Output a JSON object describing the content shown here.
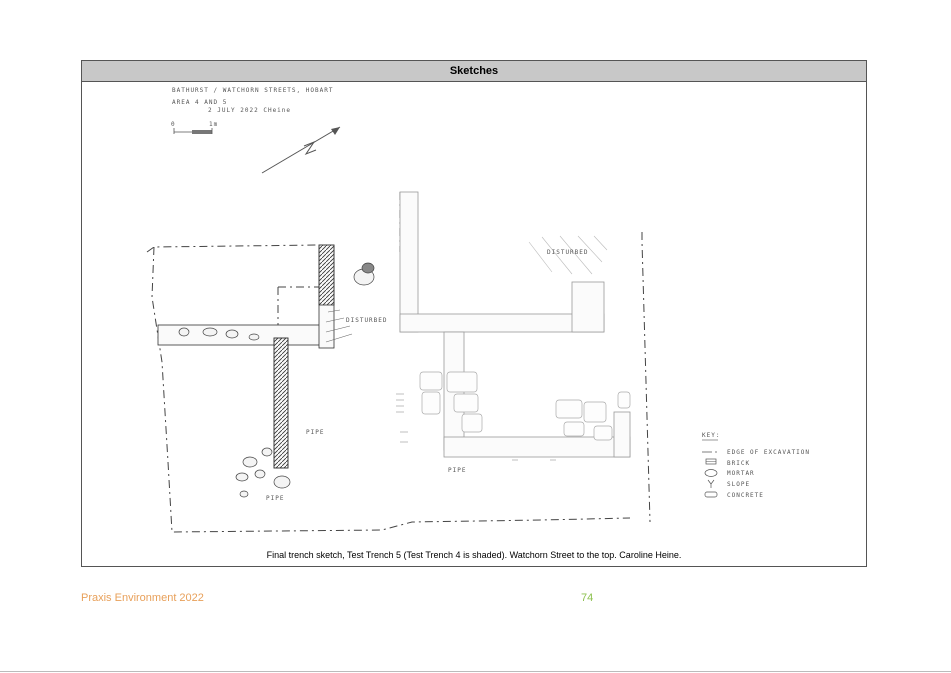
{
  "header": {
    "title": "Sketches"
  },
  "sketch": {
    "note_line1": "BATHURST / WATCHORN STREETS, HOBART",
    "note_line2": "AREA 4 AND 5",
    "note_line3": "2 JULY 2022   CHeine",
    "scale_start": "0",
    "scale_end": "1m",
    "disturbed_label_1": "DISTURBED",
    "disturbed_label_2": "DISTURBED",
    "pipe_label_1": "PIPE",
    "pipe_label_2": "PIPE",
    "pipe_label_3": "PIPE",
    "key_title": "KEY:",
    "key_items": [
      {
        "symbol": "dash-line",
        "label": "EDGE OF EXCAVATION"
      },
      {
        "symbol": "brick",
        "label": "BRICK"
      },
      {
        "symbol": "mortar",
        "label": "MORTAR"
      },
      {
        "symbol": "slope",
        "label": "SLOPE"
      },
      {
        "symbol": "concrete",
        "label": "CONCRETE"
      }
    ]
  },
  "caption": "Final trench sketch, Test Trench 5 (Test Trench 4 is shaded).  Watchorn Street to the top.  Caroline Heine.",
  "footer": {
    "publisher": "Praxis Environment 2022",
    "page_number": "74"
  },
  "colors": {
    "footer_left": "#e8a05a",
    "footer_page": "#8cc04e",
    "header_bg": "#c8c8c8"
  }
}
